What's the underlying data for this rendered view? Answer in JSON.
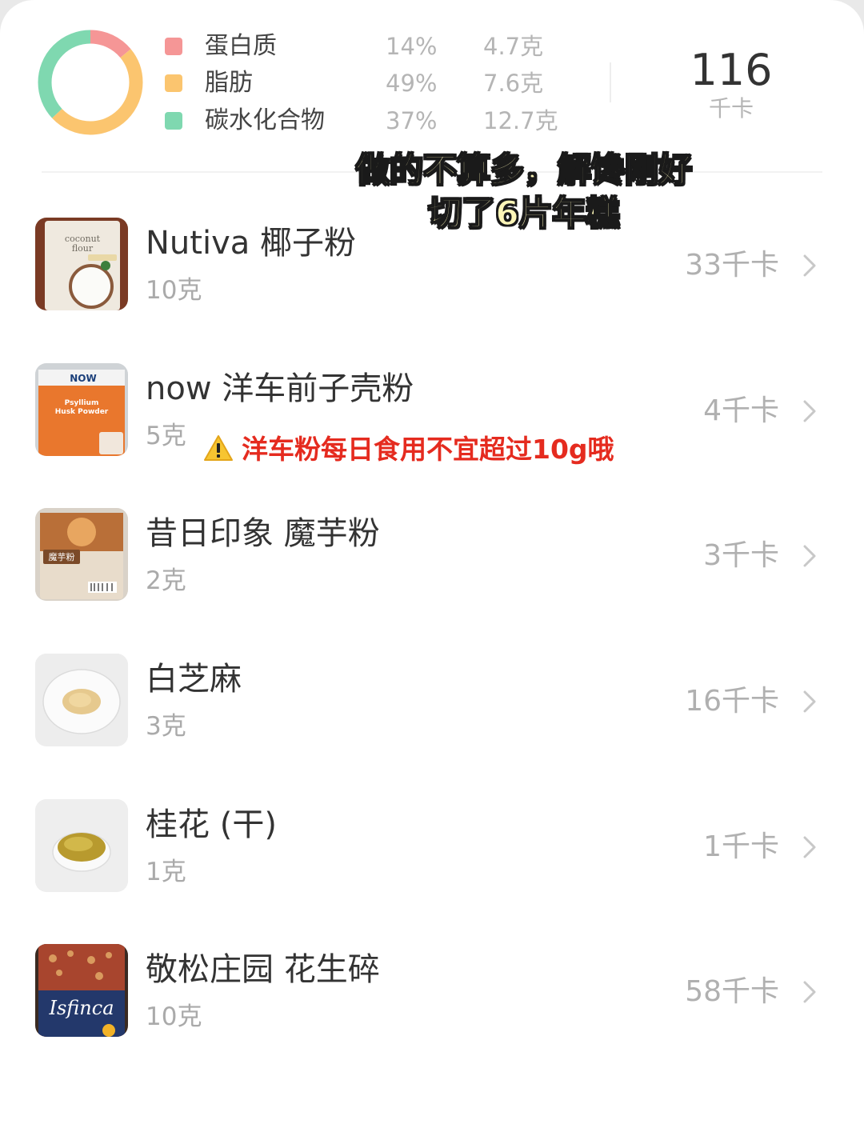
{
  "summary": {
    "macros": [
      {
        "name": "蛋白质",
        "percent": "14%",
        "amount": "4.7克",
        "color": "#f59696"
      },
      {
        "name": "脂肪",
        "percent": "49%",
        "amount": "7.6克",
        "color": "#fbc56f"
      },
      {
        "name": "碳水化合物",
        "percent": "37%",
        "amount": "12.7克",
        "color": "#7fd8b0"
      }
    ],
    "total_value": "116",
    "total_unit": "千卡"
  },
  "overlay_caption": {
    "line1": "做的不算多，解馋刚好",
    "line2": "切了6片年糕"
  },
  "foods": [
    {
      "name": "Nutiva 椰子粉",
      "weight": "10克",
      "calories": "33千卡",
      "image": "coconut-flour-package"
    },
    {
      "name": "now 洋车前子壳粉",
      "weight": "5克",
      "calories": "4千卡",
      "image": "psyllium-husk-powder-package"
    },
    {
      "name": "昔日印象 魔芋粉",
      "weight": "2克",
      "calories": "3千卡",
      "image": "konjac-powder-package"
    },
    {
      "name": "白芝麻",
      "weight": "3克",
      "calories": "16千卡",
      "image": "white-sesame-plate"
    },
    {
      "name": "桂花 (干)",
      "weight": "1克",
      "calories": "1千卡",
      "image": "dried-osmanthus-plate"
    },
    {
      "name": "敬松庄园 花生碎",
      "weight": "10克",
      "calories": "58千卡",
      "image": "chopped-peanuts-package"
    }
  ],
  "warning": {
    "icon": "warning-icon",
    "text": "洋车粉每日食用不宜超过10g哦"
  }
}
